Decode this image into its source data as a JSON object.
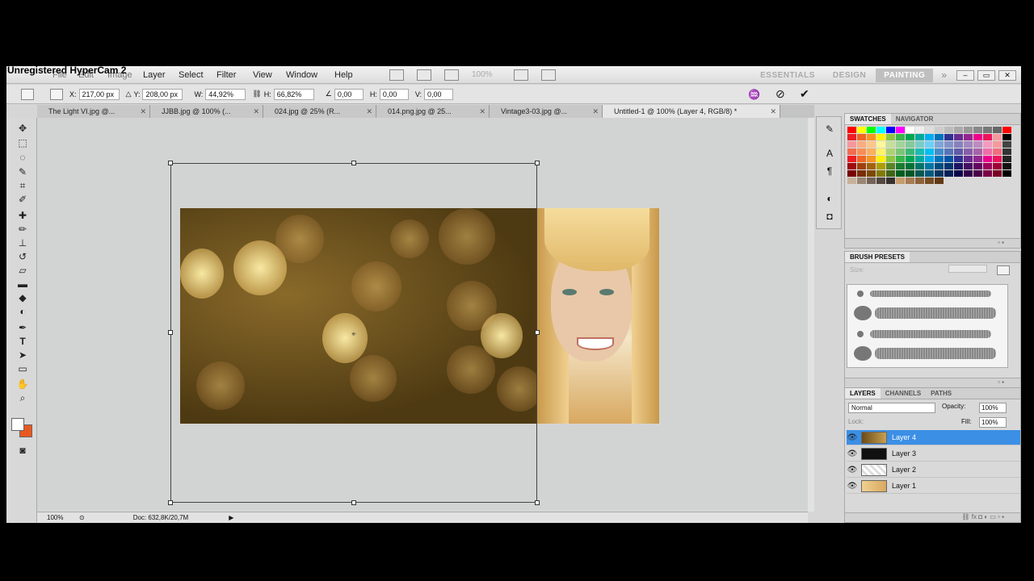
{
  "watermark": "Unregistered HyperCam 2",
  "menubar": {
    "items": [
      "File",
      "Edit",
      "Image",
      "Layer",
      "Select",
      "Filter",
      "View",
      "Window",
      "Help"
    ],
    "zoom": "100%"
  },
  "workspace": {
    "essentials": "ESSENTIALS",
    "design": "DESIGN",
    "painting": "PAINTING",
    "more": "»"
  },
  "options": {
    "x_label": "X:",
    "x_value": "217,00 px",
    "y_label": "Y:",
    "y_value": "208,00 px",
    "w_label": "W:",
    "w_value": "44,92%",
    "h_label": "H:",
    "h_value": "66,82%",
    "angle_value": "0,00",
    "hskew_label": "H:",
    "hskew_value": "0,00",
    "vskew_label": "V:",
    "vskew_value": "0,00"
  },
  "tabs": [
    {
      "label": "The Light VI.jpg @..."
    },
    {
      "label": "JJBB.jpg @ 100% (..."
    },
    {
      "label": "024.jpg @ 25% (R..."
    },
    {
      "label": "014.png.jpg @ 25..."
    },
    {
      "label": "Vintage3-03.jpg @..."
    },
    {
      "label": "Untitled-1 @ 100% (Layer 4, RGB/8) *"
    }
  ],
  "status": {
    "zoom": "100%",
    "doc": "Doc: 632,8K/20,7M"
  },
  "swatches_panel": {
    "tab_swatches": "SWATCHES",
    "tab_navigator": "NAVIGATOR",
    "colors": [
      "#ff0000",
      "#ffff00",
      "#00ff00",
      "#00ffff",
      "#0000ff",
      "#ff00ff",
      "#ffffff",
      "#eeeeee",
      "#dddddd",
      "#cccccc",
      "#bbbbbb",
      "#aaaaaa",
      "#999999",
      "#888888",
      "#777777",
      "#666666",
      "#ff0000",
      "#ee1c24",
      "#f26522",
      "#f7941d",
      "#fff200",
      "#8dc63f",
      "#39b54a",
      "#00a651",
      "#00a99d",
      "#00aeef",
      "#0072bc",
      "#2e3192",
      "#662d91",
      "#92278f",
      "#ec008c",
      "#ed145b",
      "#f6989d",
      "#000000",
      "#f5989d",
      "#f9ad81",
      "#fdc689",
      "#fff799",
      "#c4df9b",
      "#a3d39c",
      "#82ca9c",
      "#7accc8",
      "#6dcff6",
      "#7da7d9",
      "#8393ca",
      "#8781bd",
      "#a187be",
      "#bd8cbf",
      "#f49ac1",
      "#f5999d",
      "#444444",
      "#f26c4f",
      "#f68e55",
      "#fbaf5c",
      "#fff467",
      "#acd372",
      "#7cc576",
      "#3bb878",
      "#1abbb4",
      "#00bff3",
      "#438ccb",
      "#5574b9",
      "#605ca8",
      "#855fa8",
      "#a763a8",
      "#f06eaa",
      "#f26d7d",
      "#333333",
      "#ed1c24",
      "#f26522",
      "#f7941d",
      "#fff200",
      "#8dc63f",
      "#39b54a",
      "#00a651",
      "#00a99d",
      "#00aeef",
      "#0072bc",
      "#0054a6",
      "#2e3192",
      "#662d91",
      "#92278f",
      "#ec008c",
      "#ed145b",
      "#222222",
      "#9e0b0f",
      "#a0410d",
      "#a36209",
      "#aba000",
      "#598527",
      "#1a7b30",
      "#007236",
      "#00746b",
      "#0076a3",
      "#004b80",
      "#003471",
      "#1b1464",
      "#440e62",
      "#630460",
      "#9e005d",
      "#9e0039",
      "#111111",
      "#790000",
      "#7b2e00",
      "#7d4900",
      "#827b00",
      "#406618",
      "#005e20",
      "#005826",
      "#005952",
      "#005b7f",
      "#003663",
      "#002157",
      "#0d004c",
      "#32004b",
      "#4b0049",
      "#7b0046",
      "#7a0026",
      "#000000",
      "#c7b299",
      "#998675",
      "#736357",
      "#534741",
      "#37302d",
      "#c69c6d",
      "#a67c52",
      "#8c6239",
      "#754c24",
      "#603913"
    ]
  },
  "brush_panel": {
    "title": "BRUSH PRESETS",
    "size_label": "Size:"
  },
  "layers_panel": {
    "tab_layers": "LAYERS",
    "tab_channels": "CHANNELS",
    "tab_paths": "PATHS",
    "blend_mode": "Normal",
    "opacity_label": "Opacity:",
    "opacity_value": "100%",
    "lock_label": "Lock:",
    "fill_label": "Fill:",
    "fill_value": "100%",
    "layers": [
      {
        "name": "Layer 4",
        "selected": true
      },
      {
        "name": "Layer 3",
        "selected": false
      },
      {
        "name": "Layer 2",
        "selected": false
      },
      {
        "name": "Layer 1",
        "selected": false
      }
    ]
  }
}
